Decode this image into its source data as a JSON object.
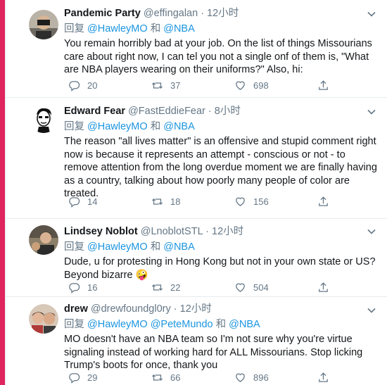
{
  "tweets": [
    {
      "name": "Pandemic Party",
      "handle": "@effingalan",
      "dot": "·",
      "time": "12小时",
      "reply_prefix": "回复",
      "mentions": [
        "@HawleyMO",
        "@NBA"
      ],
      "mention_joiner": "和",
      "text": "You remain horribly bad at your job. On the list of things Missourians care about right now, I can tel you not a single onf of them is, \"What are NBA players wearing on their uniforms?\" Also, hi:",
      "replies": "20",
      "retweets": "37",
      "likes": "698"
    },
    {
      "name": "Edward Fear",
      "handle": "@FastEddieFear",
      "dot": "·",
      "time": "8小时",
      "reply_prefix": "回复",
      "mentions": [
        "@HawleyMO",
        "@NBA"
      ],
      "mention_joiner": "和",
      "text": "The reason \"all lives matter\" is an offensive and stupid comment right now is because it represents an attempt - conscious or not - to remove attention from the long overdue moment we are finally having as a country,  talking about how poorly many people of color are treated.",
      "replies": "14",
      "retweets": "18",
      "likes": "156"
    },
    {
      "name": "Lindsey Noblot",
      "handle": "@LnoblotSTL",
      "dot": "·",
      "time": "12小时",
      "reply_prefix": "回复",
      "mentions": [
        "@HawleyMO",
        "@NBA"
      ],
      "mention_joiner": "和",
      "text": "Dude, u for protesting in Hong Kong but not in your own state or US? Beyond bizarre",
      "emoji": "🤪",
      "replies": "16",
      "retweets": "22",
      "likes": "504"
    },
    {
      "name": "drew",
      "handle": "@drewfoundgl0ry",
      "dot": "·",
      "time": "12小时",
      "reply_prefix": "回复",
      "mentions": [
        "@HawleyMO",
        "@PeteMundo",
        "@NBA"
      ],
      "mention_joiner": "和",
      "text": "MO doesn't have an NBA team so I'm not sure why you're virtue signaling instead of working hard for ALL Missourians. Stop licking Trump's boots for once, thank you",
      "replies": "29",
      "retweets": "66",
      "likes": "896"
    }
  ],
  "colors": {
    "accent_bar": "#e0245e",
    "link": "#1b95e0",
    "muted": "#657786",
    "text": "#14171a"
  },
  "icons": [
    "reply-icon",
    "retweet-icon",
    "like-icon",
    "share-icon",
    "caret-down-icon"
  ]
}
